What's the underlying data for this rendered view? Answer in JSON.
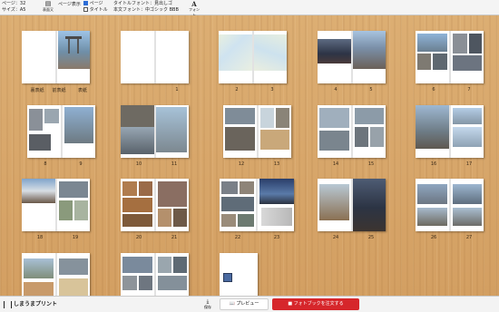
{
  "header": {
    "pages": "ページ：32",
    "size": "サイズ：A5",
    "page_display_label": "ページ表示",
    "opt_page": "ページ",
    "opt_title": "タイトル",
    "title_font": "タイトルフォント：見出しゴ",
    "body_font": "本文フォント：中ゴシック BBB",
    "btn_display": "表面又",
    "btn_font": "フォント",
    "font_glyph": "A"
  },
  "spreads": [
    {
      "l": "裏表紙",
      "c": "前表紙",
      "r": "表紙"
    },
    {
      "l": "",
      "c": "",
      "r": "1"
    },
    {
      "l": "2",
      "c": "",
      "r": "3"
    },
    {
      "l": "4",
      "c": "",
      "r": "5"
    },
    {
      "l": "6",
      "c": "",
      "r": "7"
    },
    {
      "l": "8",
      "c": "",
      "r": "9"
    },
    {
      "l": "10",
      "c": "",
      "r": "11"
    },
    {
      "l": "12",
      "c": "",
      "r": "13"
    },
    {
      "l": "14",
      "c": "",
      "r": "15"
    },
    {
      "l": "16",
      "c": "",
      "r": "17"
    },
    {
      "l": "18",
      "c": "",
      "r": "19"
    },
    {
      "l": "20",
      "c": "",
      "r": "21"
    },
    {
      "l": "22",
      "c": "",
      "r": "23"
    },
    {
      "l": "24",
      "c": "",
      "r": "25"
    },
    {
      "l": "26",
      "c": "",
      "r": "27"
    }
  ],
  "footer": {
    "logo": "しまうまプリント",
    "save": "保存",
    "preview": "プレビュー",
    "order": "フォトブックを注文する"
  },
  "colors": {
    "accent": "#d6262b",
    "check": "#2b6cd6"
  }
}
